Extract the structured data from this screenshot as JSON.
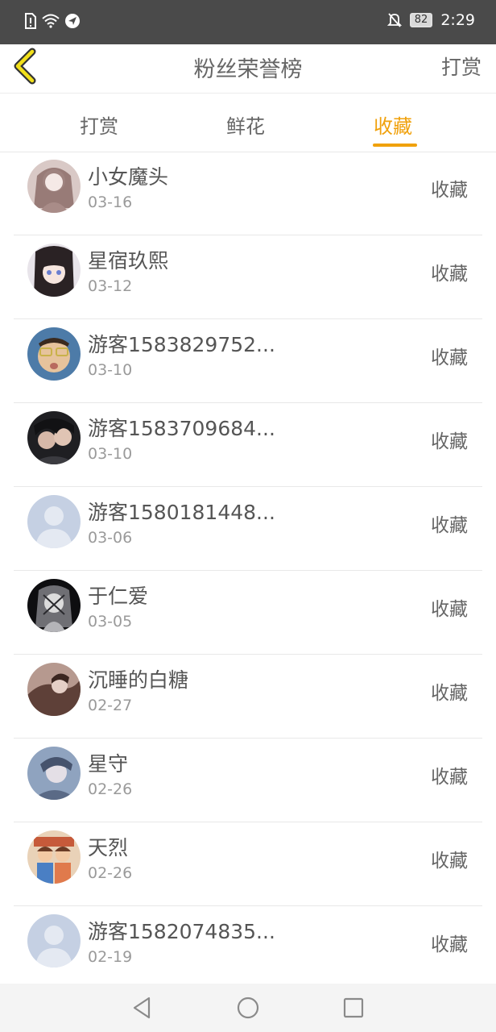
{
  "status_bar": {
    "battery": "82",
    "time": "2:29"
  },
  "header": {
    "title": "粉丝荣誉榜",
    "action_label": "打赏"
  },
  "tabs": [
    {
      "label": "打赏",
      "active": false
    },
    {
      "label": "鲜花",
      "active": false
    },
    {
      "label": "收藏",
      "active": true
    }
  ],
  "colors": {
    "accent": "#f0a10c",
    "status_bar_bg": "#4a4a4a"
  },
  "list": [
    {
      "name": "小女魔头",
      "date": "03-16",
      "action": "收藏",
      "avatar": "photo-pink"
    },
    {
      "name": "星宿玖熙",
      "date": "03-12",
      "action": "收藏",
      "avatar": "photo-anime"
    },
    {
      "name": "游客1583829752...",
      "date": "03-10",
      "action": "收藏",
      "avatar": "photo-child"
    },
    {
      "name": "游客1583709684...",
      "date": "03-10",
      "action": "收藏",
      "avatar": "photo-couple"
    },
    {
      "name": "游客1580181448...",
      "date": "03-06",
      "action": "收藏",
      "avatar": "default-avatar"
    },
    {
      "name": "于仁爱",
      "date": "03-05",
      "action": "收藏",
      "avatar": "photo-dark"
    },
    {
      "name": "沉睡的白糖",
      "date": "02-27",
      "action": "收藏",
      "avatar": "photo-brown"
    },
    {
      "name": "星守",
      "date": "02-26",
      "action": "收藏",
      "avatar": "photo-blue"
    },
    {
      "name": "天烈",
      "date": "02-26",
      "action": "收藏",
      "avatar": "photo-cartoon"
    },
    {
      "name": "游客1582074835...",
      "date": "02-19",
      "action": "收藏",
      "avatar": "default-avatar"
    }
  ]
}
